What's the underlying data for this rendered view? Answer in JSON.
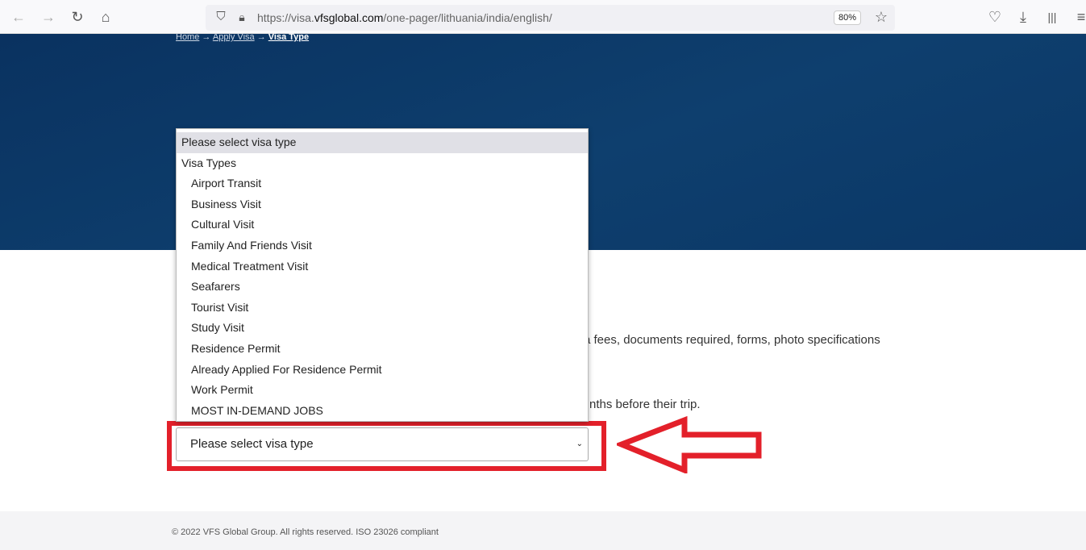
{
  "browser": {
    "url_host_prefix": "https://visa.",
    "url_host": "vfsglobal.com",
    "url_path": "/one-pager/lithuania/india/english/",
    "zoom": "80%"
  },
  "breadcrumb": [
    "Home",
    "Apply Visa",
    "Visa Type"
  ],
  "breadcrumb_sep": "→",
  "dropdown": {
    "selected": "Please select visa type",
    "group": "Visa Types",
    "options": [
      "Airport Transit",
      "Business Visit",
      "Cultural Visit",
      "Family And Friends Visit",
      "Medical Treatment Visit",
      "Seafarers",
      "Tourist Visit",
      "Study Visit",
      "Residence Permit",
      "Already Applied For Residence Permit",
      "Work Permit",
      "MOST IN-DEMAND JOBS"
    ]
  },
  "body": {
    "line1_visible": "a fees, documents required, forms, photo specifications",
    "line2_visible": "nths before their trip."
  },
  "select": {
    "value": "Please select visa type"
  },
  "annotation": {
    "color": "#e3202a"
  },
  "footer": {
    "text": "© 2022 VFS Global Group. All rights reserved. ISO 23026 compliant"
  }
}
